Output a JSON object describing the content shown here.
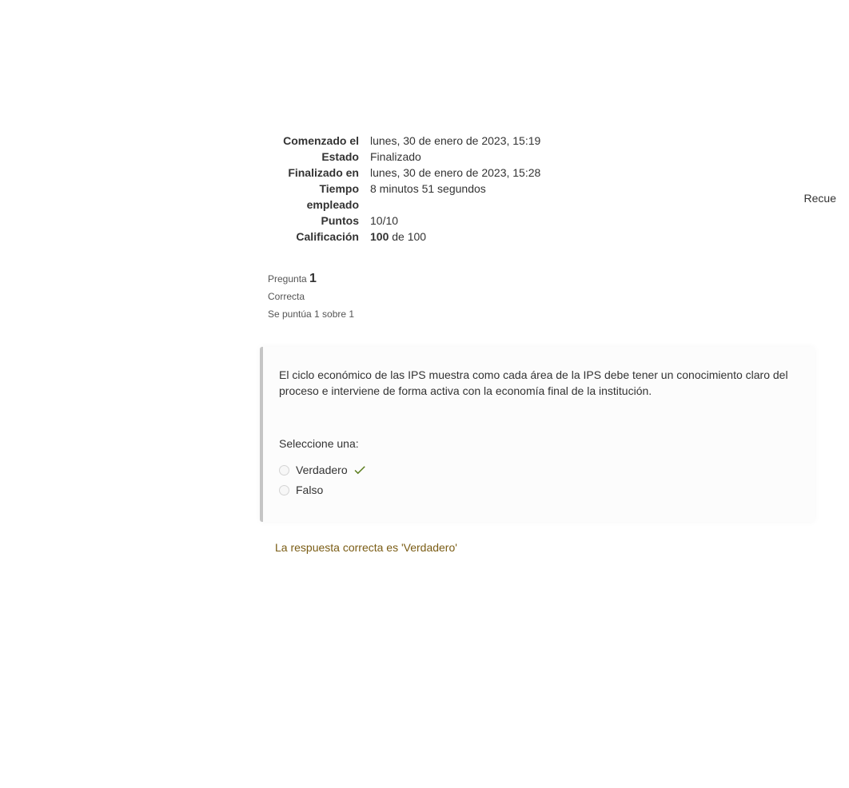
{
  "header": {
    "topLink": "Recue"
  },
  "summary": {
    "labels": {
      "started": "Comenzado el",
      "state": "Estado",
      "completed": "Finalizado en",
      "time": "Tiempo empleado",
      "points": "Puntos",
      "grade": "Calificación"
    },
    "values": {
      "started": "lunes, 30 de enero de 2023, 15:19",
      "state": "Finalizado",
      "completed": "lunes, 30 de enero de 2023, 15:28",
      "time": "8 minutos 51 segundos",
      "points": "10/10",
      "gradeStrong": "100",
      "gradeSuffix": " de 100"
    }
  },
  "question": {
    "label": "Pregunta ",
    "number": "1",
    "status": "Correcta",
    "marks": "Se puntúa 1 sobre 1",
    "text": "El ciclo económico de las IPS muestra como cada área de la IPS debe tener un conocimiento claro del proceso e interviene de forma activa con la economía final de la institución.",
    "selectPrompt": "Seleccione una:",
    "options": {
      "true": "Verdadero",
      "false": "Falso"
    },
    "feedback": "La respuesta correcta es 'Verdadero'"
  }
}
